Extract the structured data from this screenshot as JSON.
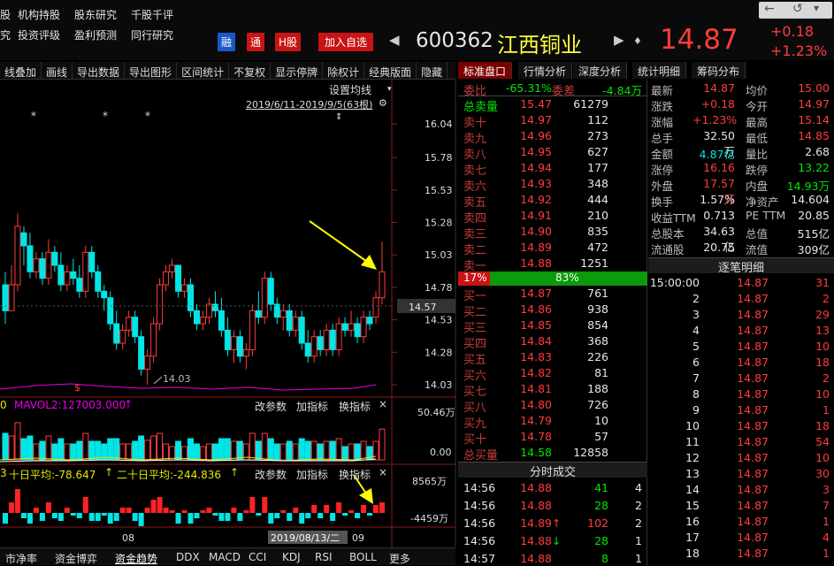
{
  "nav": {
    "row1": [
      "股",
      "机构持股",
      "股东研究",
      "千股千评"
    ],
    "row2": [
      "究",
      "投资评级",
      "盈利预测",
      "同行研究"
    ]
  },
  "tags": {
    "rong": "融",
    "tong": "通",
    "hgu": "H股",
    "add": "加入自选"
  },
  "stock": {
    "code": "600362",
    "name": "江西铜业",
    "price": "14.87",
    "change": "+0.18",
    "pct": "+1.23%"
  },
  "toolbar": [
    "线叠加",
    "画线",
    "导出数据",
    "导出图形",
    "区间统计",
    "不复权",
    "显示停牌",
    "除权计",
    "经典版面",
    "隐藏"
  ],
  "chart": {
    "setting": "设置均线",
    "range": "2019/6/11-2019/9/5(63根)",
    "current_price": "14.57",
    "low_label": "14.03",
    "date_label": "2019/08/13/二",
    "x_ticks": [
      "08",
      "09"
    ],
    "y_ticks": [
      "16.04",
      "15.78",
      "15.53",
      "15.28",
      "15.03",
      "14.78",
      "14.53",
      "14.28",
      "14.03"
    ],
    "vol_ticks": [
      "50.46万",
      "0.00"
    ],
    "money_ticks": [
      "8565万",
      "-4459万"
    ],
    "candles": [
      {
        "x": "2019-06-12",
        "o": 14.8,
        "h": 14.9,
        "l": 14.5,
        "c": 14.6
      },
      {
        "x": "2019-06-13",
        "o": 14.6,
        "h": 14.95,
        "l": 14.6,
        "c": 14.8
      },
      {
        "x": "2019-06-14",
        "o": 14.8,
        "h": 15.35,
        "l": 14.75,
        "c": 15.25
      },
      {
        "x": "2019-06-17",
        "o": 15.2,
        "h": 15.25,
        "l": 14.95,
        "c": 15.1
      },
      {
        "x": "2019-06-18",
        "o": 15.1,
        "h": 15.2,
        "l": 14.85,
        "c": 14.9
      },
      {
        "x": "2019-06-19",
        "o": 14.9,
        "h": 15.05,
        "l": 14.85,
        "c": 15.0
      },
      {
        "x": "2019-06-20",
        "o": 15.0,
        "h": 15.05,
        "l": 14.8,
        "c": 14.85
      },
      {
        "x": "2019-06-21",
        "o": 14.85,
        "h": 15.15,
        "l": 14.8,
        "c": 15.05
      },
      {
        "x": "2019-06-24",
        "o": 15.05,
        "h": 15.1,
        "l": 14.9,
        "c": 14.95
      },
      {
        "x": "2019-06-25",
        "o": 14.95,
        "h": 15.05,
        "l": 14.75,
        "c": 14.8
      },
      {
        "x": "2019-06-26",
        "o": 14.8,
        "h": 14.95,
        "l": 14.75,
        "c": 14.9
      },
      {
        "x": "2019-06-27",
        "o": 14.9,
        "h": 15.0,
        "l": 14.8,
        "c": 14.85
      },
      {
        "x": "2019-06-28",
        "o": 14.85,
        "h": 14.95,
        "l": 14.7,
        "c": 14.75
      },
      {
        "x": "2019-07-01",
        "o": 14.75,
        "h": 15.1,
        "l": 14.7,
        "c": 15.05
      },
      {
        "x": "2019-07-02",
        "o": 15.05,
        "h": 15.1,
        "l": 14.85,
        "c": 14.9
      },
      {
        "x": "2019-07-03",
        "o": 14.9,
        "h": 14.95,
        "l": 14.7,
        "c": 14.75
      },
      {
        "x": "2019-07-04",
        "o": 14.75,
        "h": 14.8,
        "l": 14.6,
        "c": 14.7
      },
      {
        "x": "2019-07-05",
        "o": 14.7,
        "h": 14.75,
        "l": 14.45,
        "c": 14.5
      },
      {
        "x": "2019-07-08",
        "o": 14.5,
        "h": 14.6,
        "l": 14.3,
        "c": 14.35
      },
      {
        "x": "2019-07-09",
        "o": 14.35,
        "h": 14.5,
        "l": 14.3,
        "c": 14.45
      },
      {
        "x": "2019-07-10",
        "o": 14.45,
        "h": 14.6,
        "l": 14.4,
        "c": 14.55
      },
      {
        "x": "2019-07-11",
        "o": 14.55,
        "h": 14.6,
        "l": 14.35,
        "c": 14.4
      },
      {
        "x": "2019-07-12",
        "o": 14.4,
        "h": 14.45,
        "l": 14.1,
        "c": 14.15
      },
      {
        "x": "2019-07-15",
        "o": 14.15,
        "h": 14.3,
        "l": 14.03,
        "c": 14.25
      },
      {
        "x": "2019-07-16",
        "o": 14.25,
        "h": 14.55,
        "l": 14.2,
        "c": 14.5
      },
      {
        "x": "2019-07-17",
        "o": 14.5,
        "h": 14.85,
        "l": 14.45,
        "c": 14.8
      },
      {
        "x": "2019-07-18",
        "o": 14.8,
        "h": 14.95,
        "l": 14.75,
        "c": 14.9
      },
      {
        "x": "2019-07-19",
        "o": 14.9,
        "h": 15.0,
        "l": 14.85,
        "c": 14.95
      },
      {
        "x": "2019-07-22",
        "o": 14.95,
        "h": 14.95,
        "l": 14.7,
        "c": 14.75
      },
      {
        "x": "2019-07-23",
        "o": 14.75,
        "h": 14.85,
        "l": 14.7,
        "c": 14.8
      },
      {
        "x": "2019-07-24",
        "o": 14.8,
        "h": 14.85,
        "l": 14.55,
        "c": 14.6
      },
      {
        "x": "2019-07-25",
        "o": 14.6,
        "h": 14.65,
        "l": 14.45,
        "c": 14.5
      },
      {
        "x": "2019-07-26",
        "o": 14.5,
        "h": 14.6,
        "l": 14.45,
        "c": 14.55
      },
      {
        "x": "2019-07-29",
        "o": 14.55,
        "h": 14.7,
        "l": 14.5,
        "c": 14.65
      },
      {
        "x": "2019-07-30",
        "o": 14.65,
        "h": 14.75,
        "l": 14.55,
        "c": 14.6
      },
      {
        "x": "2019-07-31",
        "o": 14.6,
        "h": 14.7,
        "l": 14.4,
        "c": 14.45
      },
      {
        "x": "2019-08-01",
        "o": 14.45,
        "h": 14.55,
        "l": 14.25,
        "c": 14.3
      },
      {
        "x": "2019-08-02",
        "o": 14.3,
        "h": 14.45,
        "l": 14.2,
        "c": 14.4
      },
      {
        "x": "2019-08-05",
        "o": 14.4,
        "h": 14.45,
        "l": 14.2,
        "c": 14.25
      },
      {
        "x": "2019-08-06",
        "o": 14.25,
        "h": 14.35,
        "l": 14.15,
        "c": 14.3
      },
      {
        "x": "2019-08-07",
        "o": 14.3,
        "h": 14.65,
        "l": 14.25,
        "c": 14.6
      },
      {
        "x": "2019-08-08",
        "o": 14.6,
        "h": 14.75,
        "l": 14.5,
        "c": 14.55
      },
      {
        "x": "2019-08-09",
        "o": 14.55,
        "h": 14.9,
        "l": 14.5,
        "c": 14.85
      },
      {
        "x": "2019-08-12",
        "o": 14.85,
        "h": 14.9,
        "l": 14.6,
        "c": 14.65
      },
      {
        "x": "2019-08-13",
        "o": 14.65,
        "h": 14.7,
        "l": 14.5,
        "c": 14.55
      },
      {
        "x": "2019-08-14",
        "o": 14.55,
        "h": 14.65,
        "l": 14.45,
        "c": 14.6
      },
      {
        "x": "2019-08-15",
        "o": 14.6,
        "h": 14.65,
        "l": 14.4,
        "c": 14.45
      },
      {
        "x": "2019-08-16",
        "o": 14.45,
        "h": 14.6,
        "l": 14.4,
        "c": 14.55
      },
      {
        "x": "2019-08-19",
        "o": 14.55,
        "h": 14.6,
        "l": 14.3,
        "c": 14.35
      },
      {
        "x": "2019-08-20",
        "o": 14.35,
        "h": 14.45,
        "l": 14.2,
        "c": 14.25
      },
      {
        "x": "2019-08-21",
        "o": 14.25,
        "h": 14.45,
        "l": 14.2,
        "c": 14.4
      },
      {
        "x": "2019-08-22",
        "o": 14.4,
        "h": 14.45,
        "l": 14.25,
        "c": 14.3
      },
      {
        "x": "2019-08-23",
        "o": 14.3,
        "h": 14.5,
        "l": 14.25,
        "c": 14.45
      },
      {
        "x": "2019-08-26",
        "o": 14.45,
        "h": 14.5,
        "l": 14.25,
        "c": 14.3
      },
      {
        "x": "2019-08-27",
        "o": 14.3,
        "h": 14.55,
        "l": 14.25,
        "c": 14.5
      },
      {
        "x": "2019-08-28",
        "o": 14.5,
        "h": 14.55,
        "l": 14.4,
        "c": 14.45
      },
      {
        "x": "2019-08-29",
        "o": 14.45,
        "h": 14.6,
        "l": 14.4,
        "c": 14.5
      },
      {
        "x": "2019-08-30",
        "o": 14.5,
        "h": 14.55,
        "l": 14.35,
        "c": 14.4
      },
      {
        "x": "2019-09-02",
        "o": 14.4,
        "h": 14.6,
        "l": 14.35,
        "c": 14.55
      },
      {
        "x": "2019-09-03",
        "o": 14.55,
        "h": 14.6,
        "l": 14.45,
        "c": 14.5
      },
      {
        "x": "2019-09-04",
        "o": 14.55,
        "h": 14.75,
        "l": 14.5,
        "c": 14.7
      },
      {
        "x": "2019-09-05",
        "o": 14.7,
        "h": 15.13,
        "l": 14.65,
        "c": 14.9
      }
    ]
  },
  "volume_panel": {
    "label": "MAVOL2:127003.000",
    "btns": [
      "改参数",
      "加指标",
      "换指标"
    ]
  },
  "money_panel": {
    "l1": "十日平均:-78.647",
    "l2": "二十日平均:-244.836",
    "btns": [
      "改参数",
      "加指标",
      "换指标"
    ]
  },
  "bottom_tabs": [
    "市净率",
    "资金博弈",
    "资金趋势",
    "DDX",
    "MACD",
    "CCI",
    "KDJ",
    "RSI",
    "BOLL",
    "更多"
  ],
  "right_tabs": [
    "标准盘口",
    "行情分析",
    "深度分析",
    "统计明细",
    "筹码分布"
  ],
  "order_book": {
    "webi_label": "委比",
    "webi": "-65.31%",
    "wecha_label": "委差",
    "wecha": "-4.84万",
    "zong_sell_label": "总卖量",
    "zong_sell_p": "15.47",
    "zong_sell_v": "61279",
    "asks": [
      {
        "label": "卖十",
        "price": "14.97",
        "vol": "112"
      },
      {
        "label": "卖九",
        "price": "14.96",
        "vol": "273"
      },
      {
        "label": "卖八",
        "price": "14.95",
        "vol": "627"
      },
      {
        "label": "卖七",
        "price": "14.94",
        "vol": "177"
      },
      {
        "label": "卖六",
        "price": "14.93",
        "vol": "348"
      },
      {
        "label": "卖五",
        "price": "14.92",
        "vol": "444"
      },
      {
        "label": "卖四",
        "price": "14.91",
        "vol": "210"
      },
      {
        "label": "卖三",
        "price": "14.90",
        "vol": "835"
      },
      {
        "label": "卖二",
        "price": "14.89",
        "vol": "472"
      },
      {
        "label": "卖一",
        "price": "14.88",
        "vol": "1251"
      }
    ],
    "buy_ratio": "17%",
    "sell_ratio": "83%",
    "bids": [
      {
        "label": "买一",
        "price": "14.87",
        "vol": "761"
      },
      {
        "label": "买二",
        "price": "14.86",
        "vol": "938"
      },
      {
        "label": "买三",
        "price": "14.85",
        "vol": "854"
      },
      {
        "label": "买四",
        "price": "14.84",
        "vol": "368"
      },
      {
        "label": "买五",
        "price": "14.83",
        "vol": "226"
      },
      {
        "label": "买六",
        "price": "14.82",
        "vol": "81"
      },
      {
        "label": "买七",
        "price": "14.81",
        "vol": "188"
      },
      {
        "label": "买八",
        "price": "14.80",
        "vol": "726"
      },
      {
        "label": "买九",
        "price": "14.79",
        "vol": "10"
      },
      {
        "label": "买十",
        "price": "14.78",
        "vol": "57"
      }
    ],
    "zong_buy_label": "总买量",
    "zong_buy_p": "14.58",
    "zong_buy_v": "12858"
  },
  "ticks_title": "分时成交",
  "ticks": [
    {
      "t": "14:56",
      "p": "14.88",
      "v": "41",
      "n": "4",
      "arrow": ""
    },
    {
      "t": "14:56",
      "p": "14.88",
      "v": "28",
      "n": "2",
      "arrow": ""
    },
    {
      "t": "14:56",
      "p": "14.89",
      "v": "102",
      "n": "2",
      "arrow": "↑"
    },
    {
      "t": "14:56",
      "p": "14.88",
      "v": "28",
      "n": "1",
      "arrow": "↓"
    },
    {
      "t": "14:57",
      "p": "14.88",
      "v": "8",
      "n": "1",
      "arrow": ""
    }
  ],
  "stats": [
    [
      "最新",
      "14.87",
      "均价",
      "15.00"
    ],
    [
      "涨跌",
      "+0.18",
      "今开",
      "14.97"
    ],
    [
      "涨幅",
      "+1.23%",
      "最高",
      "15.14"
    ],
    [
      "总手",
      "32.50万",
      "最低",
      "14.85"
    ],
    [
      "金额",
      "4.87亿",
      "量比",
      "2.68"
    ],
    [
      "涨停",
      "16.16",
      "跌停",
      "13.22"
    ],
    [
      "外盘",
      "17.57万",
      "内盘",
      "14.93万"
    ],
    [
      "换手",
      "1.57%",
      "净资产",
      "14.604"
    ],
    [
      "收益TTM",
      "0.713",
      "PE TTM",
      "20.85"
    ],
    [
      "总股本",
      "34.63亿",
      "总值",
      "515亿"
    ],
    [
      "流通股",
      "20.75亿",
      "流值",
      "309亿"
    ]
  ],
  "trade_title": "逐笔明细",
  "trades": [
    [
      "15:00:00",
      "14.87",
      "31"
    ],
    [
      "2",
      "14.87",
      "2"
    ],
    [
      "3",
      "14.87",
      "29"
    ],
    [
      "4",
      "14.87",
      "13"
    ],
    [
      "5",
      "14.87",
      "10"
    ],
    [
      "6",
      "14.87",
      "18"
    ],
    [
      "7",
      "14.87",
      "2"
    ],
    [
      "8",
      "14.87",
      "10"
    ],
    [
      "9",
      "14.87",
      "1"
    ],
    [
      "10",
      "14.87",
      "18"
    ],
    [
      "11",
      "14.87",
      "54"
    ],
    [
      "12",
      "14.87",
      "10"
    ],
    [
      "13",
      "14.87",
      "30"
    ],
    [
      "14",
      "14.87",
      "3"
    ],
    [
      "15",
      "14.87",
      "7"
    ],
    [
      "16",
      "14.87",
      "1"
    ],
    [
      "17",
      "14.87",
      "4"
    ],
    [
      "18",
      "14.87",
      "1"
    ]
  ]
}
